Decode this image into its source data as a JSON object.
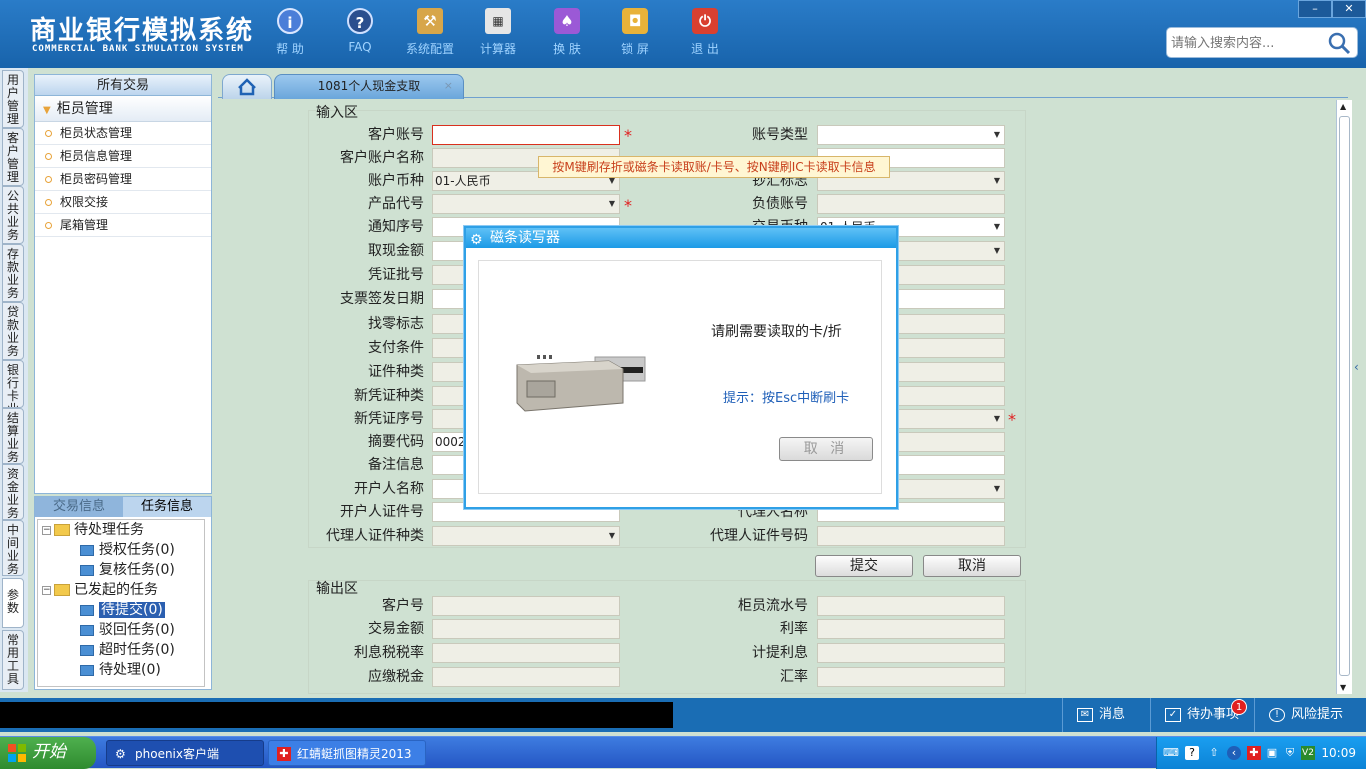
{
  "app": {
    "title_cn": "商业银行模拟系统",
    "title_en": "COMMERCIAL BANK SIMULATION SYSTEM"
  },
  "toolbar": [
    {
      "label": "帮 助",
      "icon": "help-icon"
    },
    {
      "label": "FAQ",
      "icon": "faq-icon"
    },
    {
      "label": "系统配置",
      "icon": "toolbox-icon"
    },
    {
      "label": "计算器",
      "icon": "calculator-icon"
    },
    {
      "label": "换 肤",
      "icon": "shirt-icon"
    },
    {
      "label": "锁 屏",
      "icon": "lock-icon"
    },
    {
      "label": "退 出",
      "icon": "power-icon"
    }
  ],
  "window": {
    "minimize": "–",
    "close": "✕"
  },
  "search": {
    "placeholder": "请输入搜索内容..."
  },
  "vtabs": [
    "用户管理",
    "客户管理",
    "公共业务",
    "存款业务",
    "贷款业务",
    "银行卡业务",
    "结算业务",
    "资金业务",
    "中间业务",
    "参数",
    "常用工具"
  ],
  "left_panel": {
    "header": "所有交易",
    "group": "柜员管理",
    "items": [
      "柜员状态管理",
      "柜员信息管理",
      "柜员密码管理",
      "权限交接",
      "尾箱管理"
    ]
  },
  "task_panel": {
    "tabs": [
      "交易信息",
      "任务信息"
    ],
    "pending_root": "待处理任务",
    "pending_children": [
      "授权任务(0)",
      "复核任务(0)"
    ],
    "initiated_root": "已发起的任务",
    "initiated_children": [
      "待提交(0)",
      "驳回任务(0)",
      "超时任务(0)",
      "待处理(0)"
    ]
  },
  "tabs": {
    "active_tab": "1081个人现金支取",
    "close": "×"
  },
  "input_section": {
    "title": "输入区",
    "left_fields": [
      {
        "label": "客户账号",
        "value": ""
      },
      {
        "label": "客户账户名称",
        "value": ""
      },
      {
        "label": "账户币种",
        "value": "01-人民币"
      },
      {
        "label": "产品代号",
        "value": ""
      },
      {
        "label": "通知序号",
        "value": ""
      },
      {
        "label": "取现金额",
        "value": ""
      },
      {
        "label": "凭证批号",
        "value": ""
      },
      {
        "label": "支票签发日期",
        "value": ""
      },
      {
        "label": "找零标志",
        "value": ""
      },
      {
        "label": "支付条件",
        "value": ""
      },
      {
        "label": "证件种类",
        "value": ""
      },
      {
        "label": "新凭证种类",
        "value": ""
      },
      {
        "label": "新凭证序号",
        "value": ""
      },
      {
        "label": "摘要代码",
        "value": "0002"
      },
      {
        "label": "备注信息",
        "value": ""
      },
      {
        "label": "开户人名称",
        "value": ""
      },
      {
        "label": "开户人证件号",
        "value": ""
      },
      {
        "label": "代理人证件种类",
        "value": ""
      }
    ],
    "right_fields": [
      {
        "label": "账号类型",
        "value": ""
      },
      {
        "label": "",
        "value": ""
      },
      {
        "label": "钞汇标志",
        "value": ""
      },
      {
        "label": "负债账号",
        "value": ""
      },
      {
        "label": "交易币种",
        "value": "01-人民币"
      },
      {
        "label": "",
        "value": ""
      },
      {
        "label": "",
        "value": ""
      },
      {
        "label": "",
        "value": ""
      },
      {
        "label": "",
        "value": ""
      },
      {
        "label": "",
        "value": ""
      },
      {
        "label": "",
        "value": ""
      },
      {
        "label": "",
        "value": ""
      },
      {
        "label": "",
        "value": ""
      },
      {
        "label": "",
        "value": ""
      },
      {
        "label": "",
        "value": ""
      },
      {
        "label": "",
        "value": ""
      },
      {
        "label": "代理人名称",
        "value": ""
      },
      {
        "label": "代理人证件号码",
        "value": ""
      }
    ],
    "required_mark": "*",
    "submit": "提交",
    "cancel": "取消"
  },
  "tooltip": "按M键刷存折或磁条卡读取账/卡号、按N键刷IC卡读取卡信息",
  "output_section": {
    "title": "输出区",
    "left_fields": [
      {
        "label": "客户号",
        "value": ""
      },
      {
        "label": "交易金额",
        "value": ""
      },
      {
        "label": "利息税税率",
        "value": ""
      },
      {
        "label": "应缴税金",
        "value": ""
      }
    ],
    "right_fields": [
      {
        "label": "柜员流水号",
        "value": ""
      },
      {
        "label": "利率",
        "value": ""
      },
      {
        "label": "计提利息",
        "value": ""
      },
      {
        "label": "汇率",
        "value": ""
      }
    ]
  },
  "dialog": {
    "title": "磁条读写器",
    "message": "请刷需要读取的卡/折",
    "hint": "提示：按Esc中断刷卡",
    "cancel": "取 消"
  },
  "statusbar": {
    "messages": "消息",
    "todo": "待办事项",
    "todo_count": "1",
    "risk": "风险提示"
  },
  "taskbar": {
    "start": "开始",
    "tasks": [
      "phoenix客户端",
      "红蜻蜓抓图精灵2013"
    ],
    "clock": "10:09"
  },
  "colors": {
    "topbar": "#1863ab",
    "content_bg": "#cfe1d2",
    "required": "#e02020",
    "hint": "#1f5fb8"
  }
}
